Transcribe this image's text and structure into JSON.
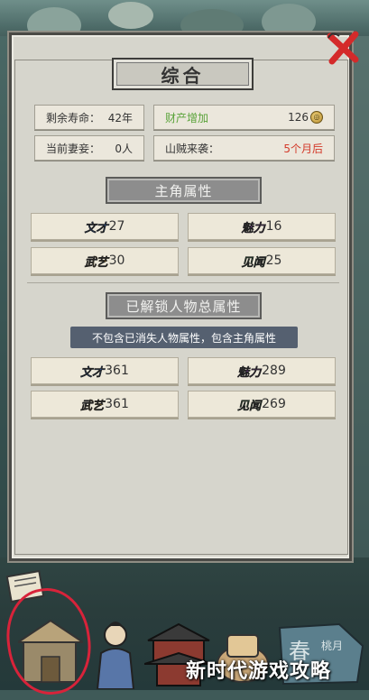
{
  "panel": {
    "title": "综合",
    "close_icon": "close-x-icon"
  },
  "info": {
    "lifespan_label": "剩余寿命：",
    "lifespan_value": "42年",
    "wealth_label": "财产增加",
    "wealth_value": "126",
    "wife_label": "当前妻妾：",
    "wife_value": "0人",
    "bandit_label": "山贼来袭：",
    "bandit_value": "5个月后"
  },
  "protagonist": {
    "header": "主角属性",
    "stats": [
      {
        "badge": "文才",
        "value": "27",
        "color": "#2b6fd6"
      },
      {
        "badge": "魅力",
        "value": "16",
        "color": "#b14bd9"
      },
      {
        "badge": "武艺",
        "value": "30",
        "color": "#e0a02c"
      },
      {
        "badge": "见闻",
        "value": "25",
        "color": "#3cb04a"
      }
    ]
  },
  "unlocked": {
    "header": "已解锁人物总属性",
    "note": "不包含已消失人物属性，包含主角属性",
    "stats": [
      {
        "badge": "文才",
        "value": "361",
        "color": "#2b6fd6"
      },
      {
        "badge": "魅力",
        "value": "289",
        "color": "#b14bd9"
      },
      {
        "badge": "武艺",
        "value": "361",
        "color": "#e0a02c"
      },
      {
        "badge": "见闻",
        "value": "269",
        "color": "#3cb04a"
      }
    ]
  },
  "colors": {
    "wealth_green": "#5aa33a",
    "bandit_red": "#d33a2a"
  },
  "watermark": "新时代游戏攻略"
}
